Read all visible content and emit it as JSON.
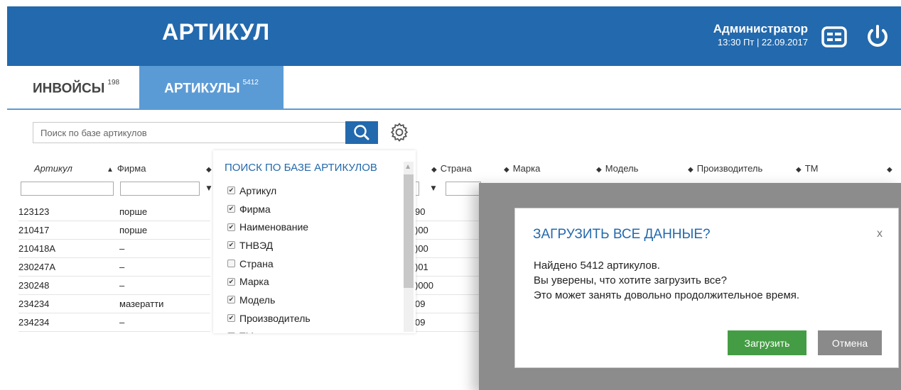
{
  "header": {
    "title": "АРТИКУЛ",
    "user_name": "Администратор",
    "user_datetime": "13:30 Пт | 22.09.2017",
    "bg_color": "#2369ad",
    "icons": [
      "menu-icon",
      "power-icon"
    ]
  },
  "tabs": [
    {
      "label": "ИНВОЙСЫ",
      "count": "198"
    },
    {
      "label": "АРТИКУЛЫ",
      "count": "5412",
      "active": true
    }
  ],
  "search": {
    "placeholder": "Поиск по базе артикулов"
  },
  "grid": {
    "columns": [
      {
        "label": "Артикул",
        "sort": "none"
      },
      {
        "label": "Фирма",
        "sort": "asc"
      },
      {
        "label": "Страна",
        "sort": "both"
      },
      {
        "label": "Марка",
        "sort": "both"
      },
      {
        "label": "Модель",
        "sort": "both"
      },
      {
        "label": "Производитель",
        "sort": "both"
      },
      {
        "label": "ТМ",
        "sort": "both"
      }
    ],
    "rows": [
      {
        "article": "123123",
        "firm": "порше",
        "right": "90"
      },
      {
        "article": "210417",
        "firm": "порше",
        "right": ")00"
      },
      {
        "article": "210418A",
        "firm": "–",
        "right": ")00"
      },
      {
        "article": "230247A",
        "firm": "–",
        "right": ")01"
      },
      {
        "article": "230248",
        "firm": "–",
        "right": ")000"
      },
      {
        "article": "234234",
        "firm": "мазератти",
        "right": "09"
      },
      {
        "article": "234234",
        "firm": "–",
        "right": "09"
      }
    ]
  },
  "column_panel": {
    "title": "ПОИСК ПО БАЗЕ АРТИКУЛОВ",
    "items": [
      {
        "label": "Артикул",
        "checked": true
      },
      {
        "label": "Фирма",
        "checked": true
      },
      {
        "label": "Наименование",
        "checked": true
      },
      {
        "label": "ТНВЭД",
        "checked": true
      },
      {
        "label": "Страна",
        "checked": false
      },
      {
        "label": "Марка",
        "checked": true
      },
      {
        "label": "Модель",
        "checked": true
      },
      {
        "label": "Производитель",
        "checked": true
      },
      {
        "label": "ТМ",
        "checked": true
      }
    ]
  },
  "modal": {
    "title": "ЗАГРУЗИТЬ ВСЕ ДАННЫЕ?",
    "close_label": "x",
    "line1": "Найдено 5412 артикулов.",
    "line2": "Вы уверены, что хотите загрузить все?",
    "line3": "Это может занять довольно продолжительное время.",
    "confirm_label": "Загрузить",
    "cancel_label": "Отмена",
    "confirm_color": "#449d44",
    "cancel_color": "#8a8a8a"
  }
}
